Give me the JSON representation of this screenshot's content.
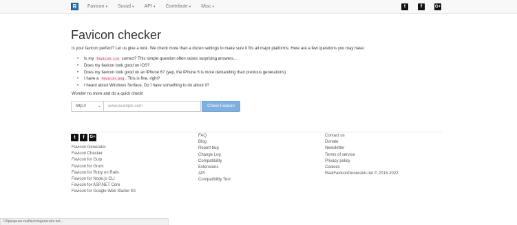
{
  "navbar": {
    "brand_letter": "R",
    "items": [
      {
        "label": "Favicon"
      },
      {
        "label": "Social"
      },
      {
        "label": "API"
      },
      {
        "label": "Contribute"
      },
      {
        "label": "Misc"
      }
    ],
    "social": {
      "twitter": "t",
      "facebook": "f",
      "google": "G+"
    }
  },
  "main": {
    "title": "Favicon checker",
    "intro": "Is your favicon perfect? Let us give a look. We check more than a dozen settings to make sure it fits all major platforms. Here are a few questions you may have:",
    "questions": [
      {
        "before": "Is my ",
        "code": "favicon.ico",
        "after": " correct? This simple question often raises surprising answers..."
      },
      {
        "text": "Does my favicon look good on iOS?"
      },
      {
        "text": "Does my favicon look good on an iPhone 6? (yep, the iPhone 6 is more demanding than previous generations)"
      },
      {
        "before": "I have a ",
        "code": "favicon.png",
        "after": ". This is fine, right?"
      },
      {
        "text": "I heard about Windows Surface. Do I have something to do about it?"
      }
    ],
    "cta": "Wonder no more and do a quick check!",
    "form": {
      "protocol": "http://",
      "url_placeholder": "www.example.com",
      "button": "Check Favicon"
    }
  },
  "footer": {
    "social": {
      "twitter": "t",
      "facebook": "f",
      "google": "G+"
    },
    "col1": [
      "Favicon Generator",
      "Favicon Checker",
      "Favicon for Gulp",
      "Favicon for Grunt",
      "Favicon for Ruby on Rails",
      "Favicon for Node.js CLI",
      "Favicon for ASP.NET Core",
      "Favicon for Google Web Starter Kit"
    ],
    "col2": [
      "FAQ",
      "Blog",
      "Report bug",
      "Change Log",
      "Compatibility",
      "Extensions",
      "API",
      "Compatibility Test"
    ],
    "col3": [
      "Contact us",
      "Donate",
      "Newsletter",
      "Terms of service",
      "Privacy policy",
      "Cookies",
      "RealFaviconGenerator.net © 2013-2022"
    ]
  },
  "statusbar": {
    "text": "Обращение realfavicongenerator.net..."
  }
}
